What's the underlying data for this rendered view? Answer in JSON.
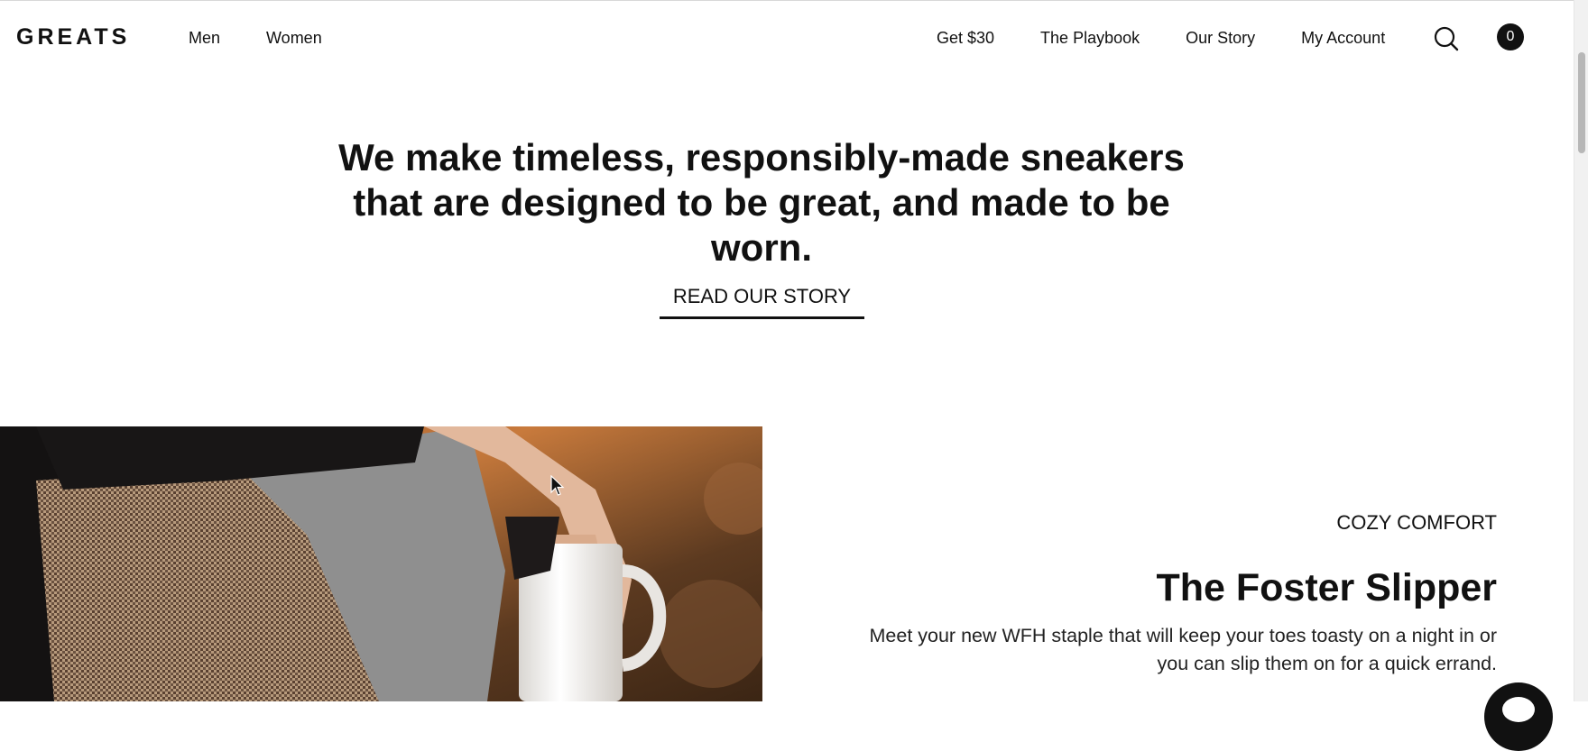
{
  "brand": {
    "logo": "GREATS"
  },
  "nav": {
    "left": [
      "Men",
      "Women"
    ],
    "right": [
      "Get $30",
      "The Playbook",
      "Our Story",
      "My Account"
    ],
    "cart_count": "0"
  },
  "hero": {
    "heading": "We make timeless, responsibly-made sneakers that are designed to be great, and made to be worn.",
    "cta": "READ OUR STORY"
  },
  "feature": {
    "eyebrow": "COZY COMFORT",
    "title": "The Foster Slipper",
    "description": "Meet your new WFH staple that will keep your toes toasty on a night in or you can slip them on for a quick errand."
  },
  "icons": {
    "search": "search-icon",
    "chat": "chat-icon"
  }
}
